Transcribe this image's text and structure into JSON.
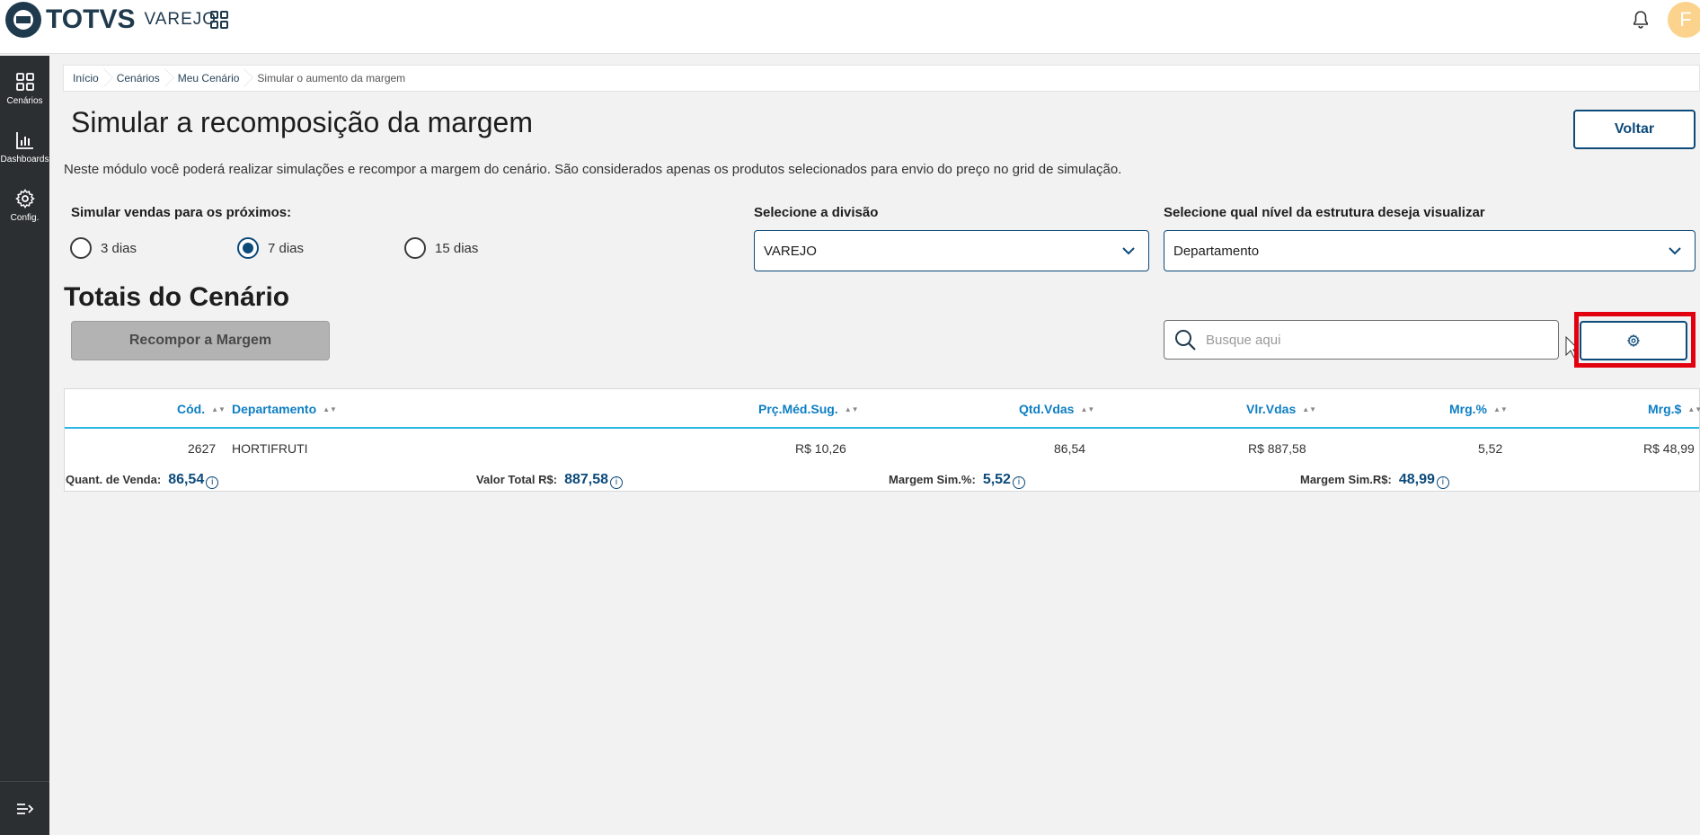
{
  "header": {
    "brand": "TOTVS",
    "brand_sub": "VAREJO",
    "avatar_initial": "F"
  },
  "sidebar": {
    "items": [
      {
        "label": "Cenários",
        "icon": "grid-icon"
      },
      {
        "label": "Dashboards",
        "icon": "bar-chart-icon"
      },
      {
        "label": "Config.",
        "icon": "gear-icon"
      }
    ]
  },
  "breadcrumb": [
    "Início",
    "Cenários",
    "Meu Cenário",
    "Simular o aumento da margem"
  ],
  "page": {
    "title": "Simular a recomposição da margem",
    "back_label": "Voltar",
    "description": "Neste módulo você poderá realizar simulações e recompor a margem do cenário. São considerados apenas os produtos selecionados para envio do preço no grid de simulação."
  },
  "simulation": {
    "label": "Simular vendas para os próximos:",
    "options": [
      "3 dias",
      "7 dias",
      "15 dias"
    ],
    "selected": "7 dias"
  },
  "division": {
    "label": "Selecione a divisão",
    "value": "VAREJO"
  },
  "structure": {
    "label": "Selecione qual nível da estrutura deseja visualizar",
    "value": "Departamento"
  },
  "totals_section": {
    "title": "Totais do Cenário",
    "recompose_label": "Recompor a Margem",
    "search_placeholder": "Busque aqui"
  },
  "table": {
    "columns": [
      "Cód.",
      "Departamento",
      "Prç.Méd.Sug.",
      "Qtd.Vdas",
      "Vlr.Vdas",
      "Mrg.%",
      "Mrg.$"
    ],
    "rows": [
      [
        "2627",
        "HORTIFRUTI",
        "R$ 10,26",
        "86,54",
        "R$ 887,58",
        "5,52",
        "R$ 48,99"
      ]
    ],
    "totals": [
      {
        "label": "Quant. de Venda:",
        "value": "86,54"
      },
      {
        "label": "Valor Total R$:",
        "value": "887,58"
      },
      {
        "label": "Margem Sim.%:",
        "value": "5,52"
      },
      {
        "label": "Margem Sim.R$:",
        "value": "48,99"
      }
    ]
  },
  "colors": {
    "primary": "#0c4a7a",
    "header_text": "#0d7ec4",
    "highlight": "#e2000f",
    "sidebar_bg": "#2b2f31"
  }
}
